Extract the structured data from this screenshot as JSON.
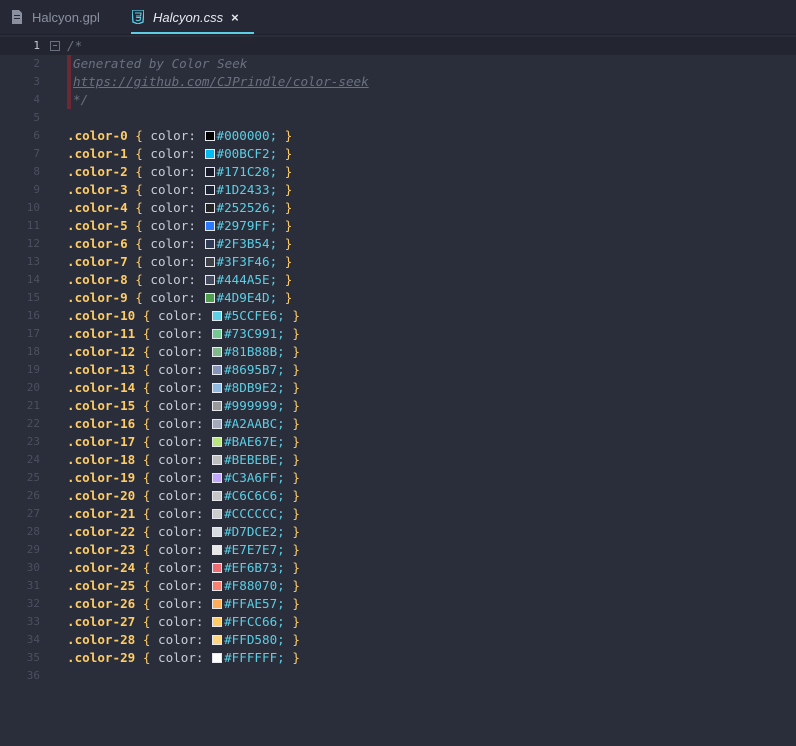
{
  "tabs": [
    {
      "label": "Halcyon.gpl",
      "active": false,
      "icon": "file-icon"
    },
    {
      "label": "Halcyon.css",
      "active": true,
      "icon": "css3-icon"
    }
  ],
  "close_symbol": "×",
  "comment_lines": [
    "/*",
    "Generated by Color Seek",
    "https://github.com/CJPrindle/color-seek",
    "*/"
  ],
  "css_property": "color:",
  "colors": [
    {
      "name": ".color-0",
      "hex": "#000000"
    },
    {
      "name": ".color-1",
      "hex": "#00BCF2"
    },
    {
      "name": ".color-2",
      "hex": "#171C28"
    },
    {
      "name": ".color-3",
      "hex": "#1D2433"
    },
    {
      "name": ".color-4",
      "hex": "#252526"
    },
    {
      "name": ".color-5",
      "hex": "#2979FF"
    },
    {
      "name": ".color-6",
      "hex": "#2F3B54"
    },
    {
      "name": ".color-7",
      "hex": "#3F3F46"
    },
    {
      "name": ".color-8",
      "hex": "#444A5E"
    },
    {
      "name": ".color-9",
      "hex": "#4D9E4D"
    },
    {
      "name": ".color-10",
      "hex": "#5CCFE6"
    },
    {
      "name": ".color-11",
      "hex": "#73C991"
    },
    {
      "name": ".color-12",
      "hex": "#81B88B"
    },
    {
      "name": ".color-13",
      "hex": "#8695B7"
    },
    {
      "name": ".color-14",
      "hex": "#8DB9E2"
    },
    {
      "name": ".color-15",
      "hex": "#999999"
    },
    {
      "name": ".color-16",
      "hex": "#A2AABC"
    },
    {
      "name": ".color-17",
      "hex": "#BAE67E"
    },
    {
      "name": ".color-18",
      "hex": "#BEBEBE"
    },
    {
      "name": ".color-19",
      "hex": "#C3A6FF"
    },
    {
      "name": ".color-20",
      "hex": "#C6C6C6"
    },
    {
      "name": ".color-21",
      "hex": "#CCCCCC"
    },
    {
      "name": ".color-22",
      "hex": "#D7DCE2"
    },
    {
      "name": ".color-23",
      "hex": "#E7E7E7"
    },
    {
      "name": ".color-24",
      "hex": "#EF6B73"
    },
    {
      "name": ".color-25",
      "hex": "#F88070"
    },
    {
      "name": ".color-26",
      "hex": "#FFAE57"
    },
    {
      "name": ".color-27",
      "hex": "#FFCC66"
    },
    {
      "name": ".color-28",
      "hex": "#FFD580"
    },
    {
      "name": ".color-29",
      "hex": "#FFFFFF"
    }
  ],
  "line_numbers": [
    "1",
    "2",
    "3",
    "4",
    "5",
    "6",
    "7",
    "8",
    "9",
    "10",
    "11",
    "12",
    "13",
    "14",
    "15",
    "16",
    "17",
    "18",
    "19",
    "20",
    "21",
    "22",
    "23",
    "24",
    "25",
    "26",
    "27",
    "28",
    "29",
    "30",
    "31",
    "32",
    "33",
    "34",
    "35",
    "36"
  ],
  "current_line": 1,
  "fold_symbol": "−",
  "theme": {
    "selector": "#ffcc66",
    "value": "#5ccfe6",
    "comment": "#6b7180",
    "accent": "#5ccfe6"
  }
}
